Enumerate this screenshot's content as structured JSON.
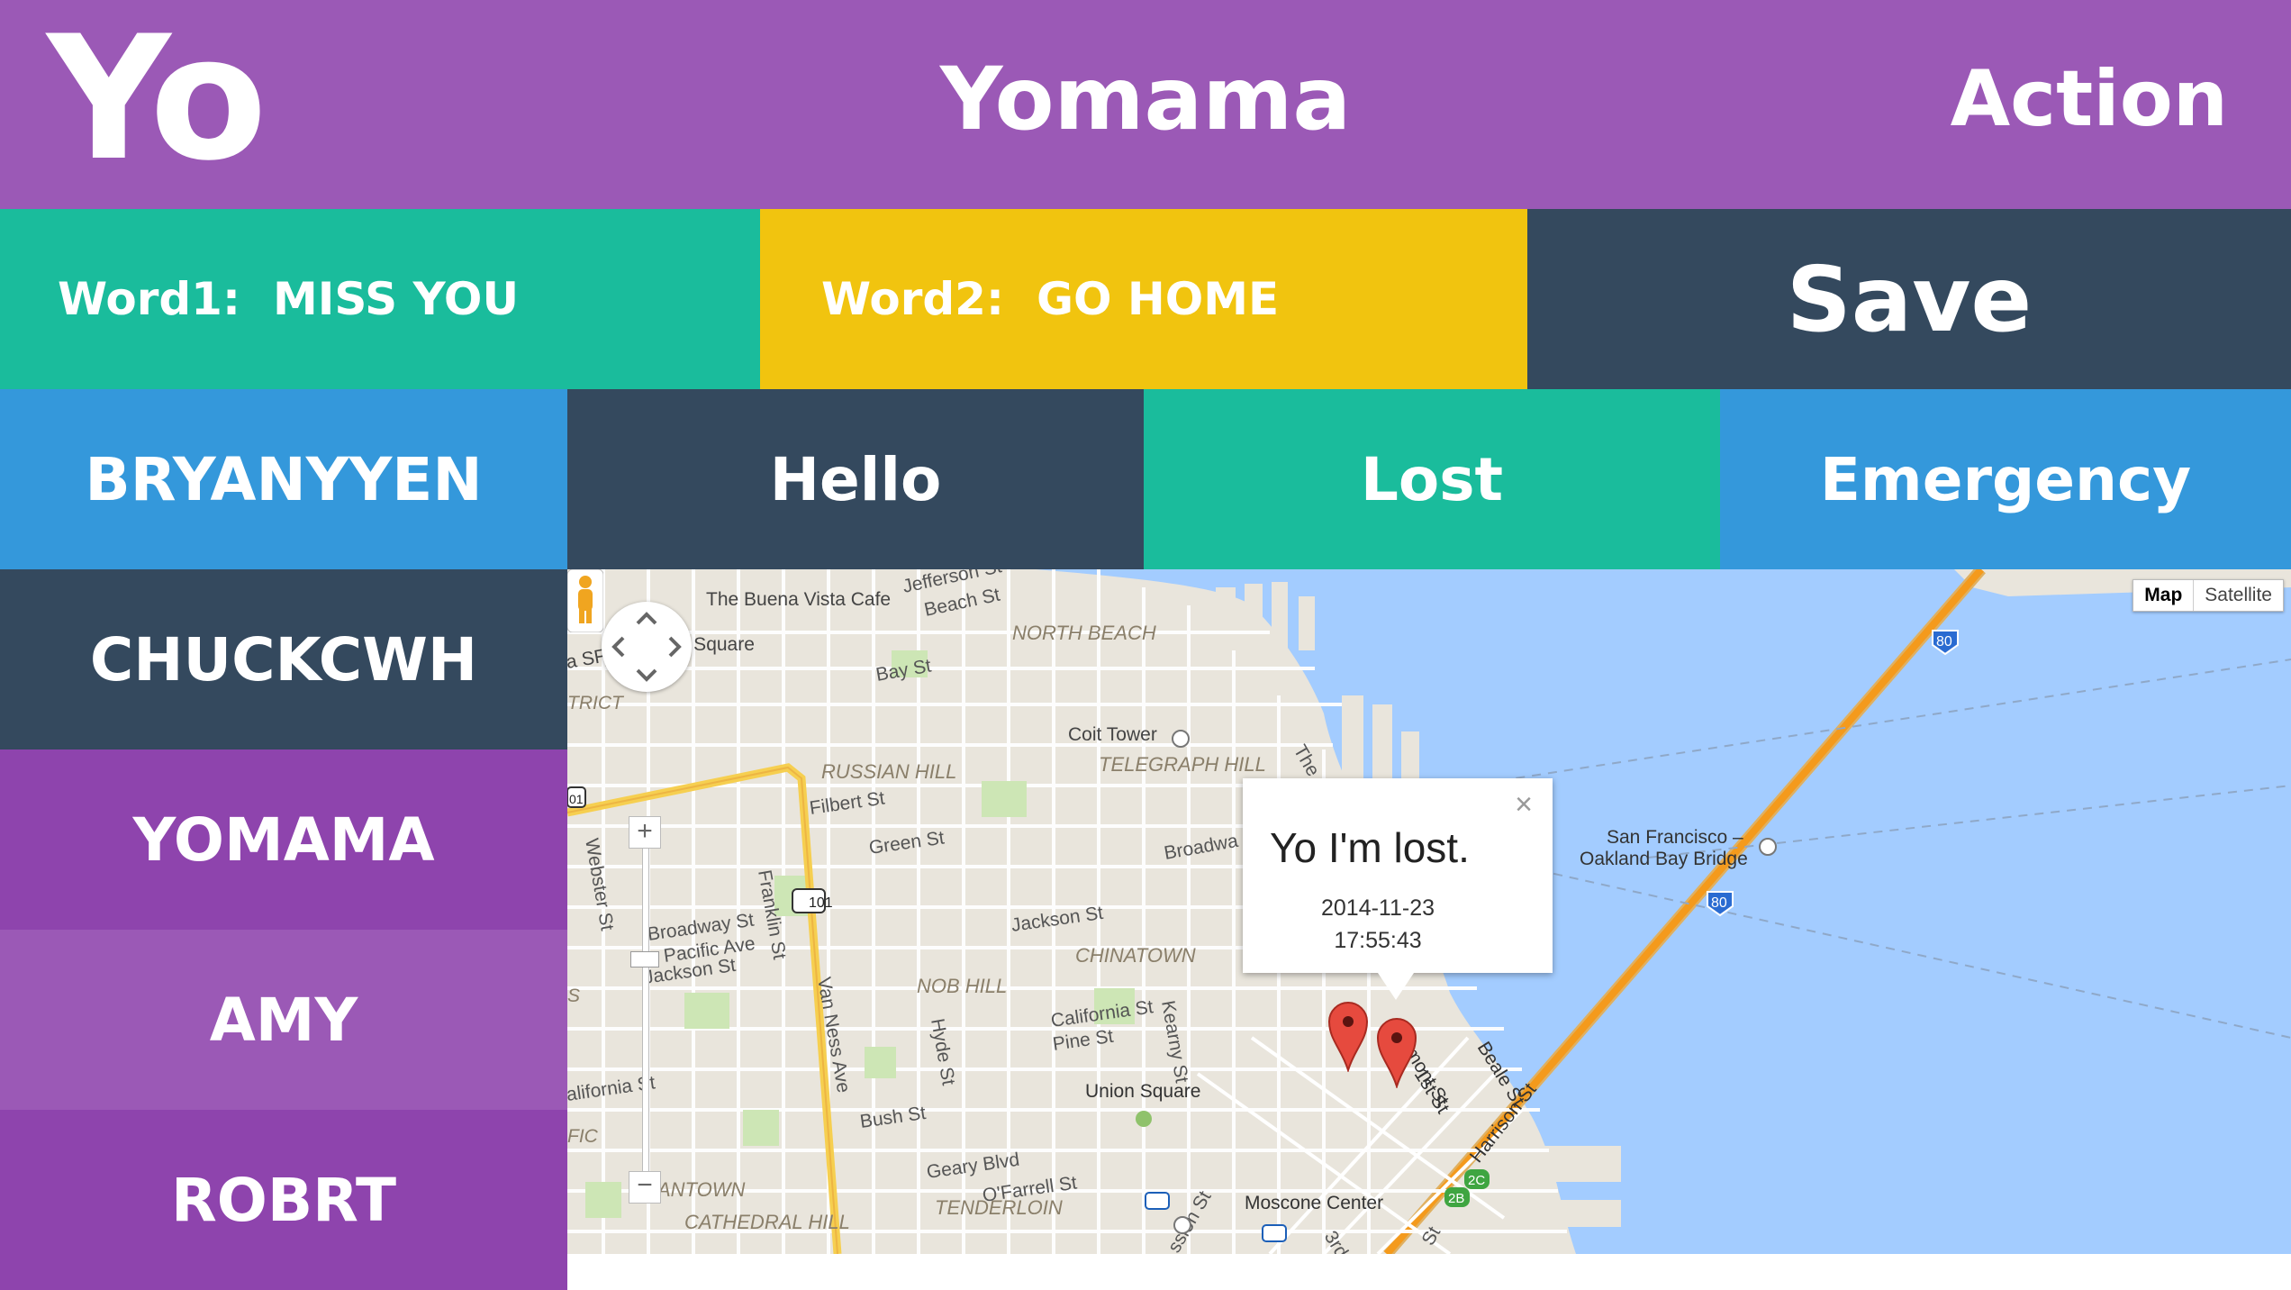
{
  "header": {
    "logo": "Yo",
    "title": "Yomama",
    "action_label": "Action"
  },
  "words": {
    "word1_label": "Word1:",
    "word1_value": "MISS YOU",
    "word2_label": "Word2:",
    "word2_value": "GO HOME",
    "save_label": "Save"
  },
  "actions": [
    "BRYANYYEN",
    "Hello",
    "Lost",
    "Emergency"
  ],
  "friends": [
    "CHUCKCWH",
    "YOMAMA",
    "AMY",
    "ROBRT"
  ],
  "map": {
    "type_controls": {
      "map": "Map",
      "satellite": "Satellite"
    },
    "labels": {
      "buena_vista": "The Buena Vista Cafe",
      "jefferson": "Jefferson St",
      "beach": "Beach St",
      "north_beach": "NORTH BEACH",
      "ghirardelli": "rdelli Square",
      "bay": "Bay St",
      "rict": "TRICT",
      "coit": "Coit Tower",
      "telegraph": "TELEGRAPH HILL",
      "russian_hill": "RUSSIAN HILL",
      "filbert": "Filbert St",
      "green": "Green St",
      "broadway_e": "Broadwa",
      "the_emb": "The",
      "sf_bridge_1": "San Francisco –",
      "sf_bridge_2": "Oakland Bay Bridge",
      "webster": "Webster St",
      "franklin": "Franklin St",
      "broadway_w": "Broadway St",
      "pacific": "Pacific Ave",
      "jackson_w": "Jackson St",
      "jackson_e": "Jackson St",
      "chinatown": "CHINATOWN",
      "nob_hill": "NOB HILL",
      "van_ness": "Van Ness Ave",
      "hyde": "Hyde St",
      "california_e": "California St",
      "pine": "Pine St",
      "kearny": "Kearny St",
      "fremont": "remont St",
      "beale": "Beale St",
      "first": "1st St",
      "harrison": "Harrison St",
      "union_square": "Union Square",
      "california_w": "alifornia St",
      "bush": "Bush St",
      "fic": "FIC",
      "geary": "Geary Blvd",
      "ofarrell": "O'Farrell St",
      "tenderloin": "TENDERLOIN",
      "antown": "ANTOWN",
      "cathedral": "CATHEDRAL HILL",
      "moscone": "Moscone Center",
      "mission": "ssion St",
      "third": "3rd",
      "st_b": "St",
      "s_edge": "S",
      "sf_edge": "a SF",
      "hwy101": "101",
      "hwy101b": "01",
      "i80": "80",
      "r2c": "2C",
      "r2b": "2B"
    },
    "infowindow": {
      "close": "×",
      "title": "Yo I'm lost.",
      "date": "2014-11-23",
      "time": "17:55:43"
    }
  },
  "colors": {
    "purple": "#9b59b6",
    "dark_purple": "#8e44ad",
    "teal": "#1abc9c",
    "yellow": "#f1c40f",
    "navy": "#34495e",
    "blue": "#3498db",
    "water": "#a3ccff",
    "land": "#e9e5dc",
    "highway": "#f49a1c",
    "marker": "#e64a3e"
  }
}
